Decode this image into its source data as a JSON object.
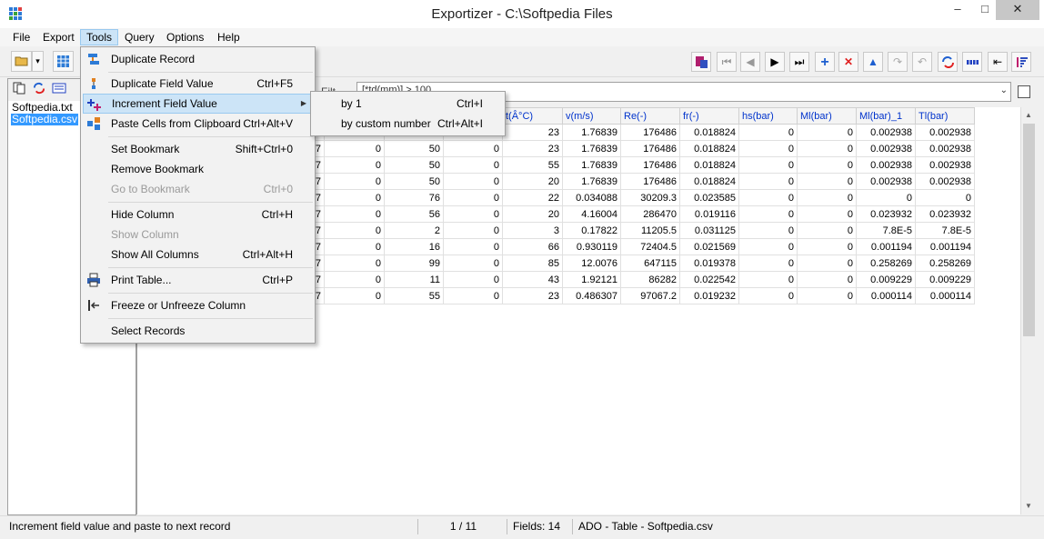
{
  "window": {
    "title": "Exportizer - C:\\Softpedia Files",
    "minimize": "–",
    "maximize": "□",
    "close": "✕"
  },
  "menubar": [
    "File",
    "Export",
    "Tools",
    "Query",
    "Options",
    "Help"
  ],
  "toolbar": {
    "open_dd": "▾"
  },
  "left_panel": {
    "files": [
      "Softpedia.txt",
      "Softpedia.csv"
    ]
  },
  "filter": {
    "label": "Filt",
    "value": "[*td(mm)] > 100",
    "dropdown": "⌄"
  },
  "grid": {
    "headers": [
      "",
      "",
      "",
      "t(Â°C)",
      "v(m/s)",
      "Re(-)",
      "fr(-)",
      "hs(bar)",
      "Ml(bar)",
      "Ml(bar)_1",
      "Tl(bar)"
    ],
    "rows": [
      [
        "",
        "",
        "",
        "23",
        "1.76839",
        "176486",
        "0.018824",
        "0",
        "0",
        "0.002938",
        "0.002938"
      ],
      [
        "57",
        "0",
        "50",
        "0",
        "23",
        "1.76839",
        "176486",
        "0.018824",
        "0",
        "0",
        "0.002938",
        "0.002938"
      ],
      [
        "57",
        "0",
        "50",
        "0",
        "55",
        "1.76839",
        "176486",
        "0.018824",
        "0",
        "0",
        "0.002938",
        "0.002938"
      ],
      [
        "57",
        "0",
        "50",
        "0",
        "20",
        "1.76839",
        "176486",
        "0.018824",
        "0",
        "0",
        "0.002938",
        "0.002938"
      ],
      [
        "57",
        "0",
        "76",
        "0",
        "22",
        "0.034088",
        "30209.3",
        "0.023585",
        "0",
        "0",
        "0",
        "0"
      ],
      [
        "57",
        "0",
        "56",
        "0",
        "20",
        "4.16004",
        "286470",
        "0.019116",
        "0",
        "0",
        "0.023932",
        "0.023932"
      ],
      [
        "57",
        "0",
        "2",
        "0",
        "3",
        "0.17822",
        "11205.5",
        "0.031125",
        "0",
        "0",
        "7.8E-5",
        "7.8E-5"
      ],
      [
        "57",
        "0",
        "16",
        "0",
        "66",
        "0.930119",
        "72404.5",
        "0.021569",
        "0",
        "0",
        "0.001194",
        "0.001194"
      ],
      [
        "57",
        "0",
        "99",
        "0",
        "85",
        "12.0076",
        "647115",
        "0.019378",
        "0",
        "0",
        "0.258269",
        "0.258269"
      ],
      [
        "57",
        "0",
        "11",
        "0",
        "43",
        "1.92121",
        "86282",
        "0.022542",
        "0",
        "0",
        "0.009229",
        "0.009229"
      ],
      [
        "57",
        "0",
        "55",
        "0",
        "23",
        "0.486307",
        "97067.2",
        "0.019232",
        "0",
        "0",
        "0.000114",
        "0.000114"
      ]
    ]
  },
  "tools_menu": {
    "items": [
      {
        "label": "Duplicate Record",
        "shortcut": "",
        "icon": "duplicate-record-icon"
      },
      {
        "label": "Duplicate Field Value",
        "shortcut": "Ctrl+F5",
        "icon": "duplicate-field-icon"
      },
      {
        "label": "Increment Field Value",
        "shortcut": "",
        "icon": "increment-icon",
        "submenu": true
      },
      {
        "label": "Paste Cells from Clipboard",
        "shortcut": "Ctrl+Alt+V",
        "icon": "paste-cells-icon"
      },
      {
        "label": "Set Bookmark",
        "shortcut": "Shift+Ctrl+0"
      },
      {
        "label": "Remove Bookmark",
        "shortcut": ""
      },
      {
        "label": "Go to Bookmark",
        "shortcut": "Ctrl+0",
        "disabled": true
      },
      {
        "label": "Hide Column",
        "shortcut": "Ctrl+H"
      },
      {
        "label": "Show Column",
        "shortcut": "",
        "disabled": true
      },
      {
        "label": "Show All Columns",
        "shortcut": "Ctrl+Alt+H"
      },
      {
        "label": "Print Table...",
        "shortcut": "Ctrl+P",
        "icon": "printer-icon"
      },
      {
        "label": "Freeze or Unfreeze Column",
        "shortcut": "",
        "icon": "freeze-icon"
      },
      {
        "label": "Select Records",
        "shortcut": ""
      }
    ]
  },
  "increment_submenu": {
    "items": [
      {
        "label": "by 1",
        "shortcut": "Ctrl+I"
      },
      {
        "label": "by custom number",
        "shortcut": "Ctrl+Alt+I"
      }
    ]
  },
  "status": {
    "hint": "Increment field value and paste to next record",
    "position": "1 / 11",
    "fields": "Fields: 14",
    "source": "ADO - Table - Softpedia.csv"
  },
  "colors": {
    "accent": "#0033cc",
    "selection": "#3399ff",
    "menu_hover": "#cce4f7"
  }
}
